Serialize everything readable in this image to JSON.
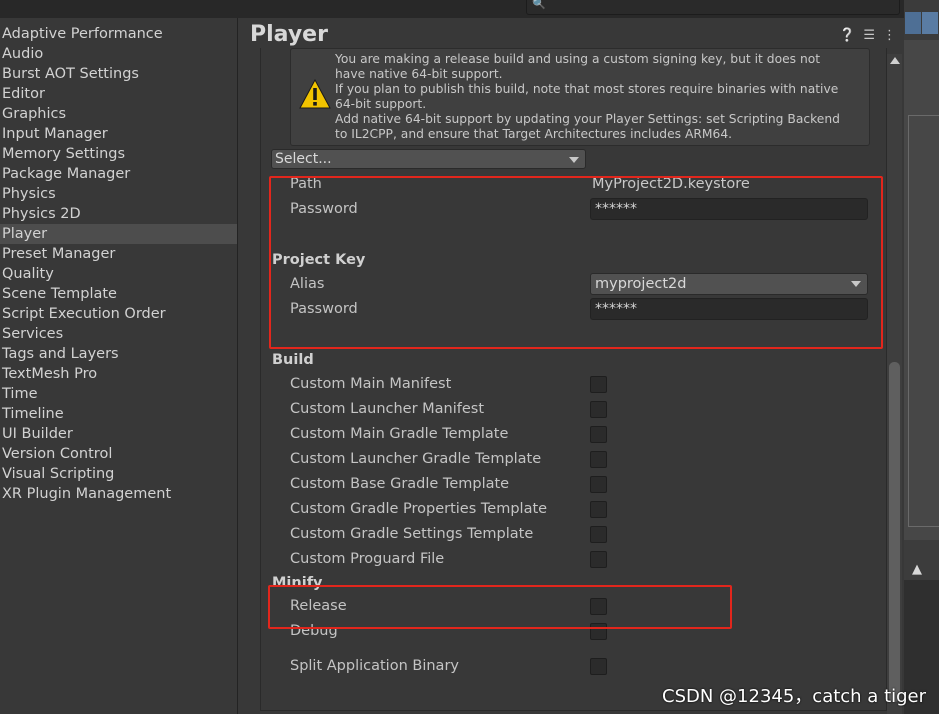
{
  "search": {
    "placeholder": ""
  },
  "sidebar": {
    "items": [
      {
        "label": "Adaptive Performance"
      },
      {
        "label": "Audio"
      },
      {
        "label": "Burst AOT Settings"
      },
      {
        "label": "Editor"
      },
      {
        "label": "Graphics"
      },
      {
        "label": "Input Manager"
      },
      {
        "label": "Memory Settings"
      },
      {
        "label": "Package Manager"
      },
      {
        "label": "Physics"
      },
      {
        "label": "Physics 2D"
      },
      {
        "label": "Player",
        "selected": true
      },
      {
        "label": "Preset Manager"
      },
      {
        "label": "Quality"
      },
      {
        "label": "Scene Template"
      },
      {
        "label": "Script Execution Order"
      },
      {
        "label": "Services"
      },
      {
        "label": "Tags and Layers"
      },
      {
        "label": "TextMesh Pro"
      },
      {
        "label": "Time"
      },
      {
        "label": "Timeline"
      },
      {
        "label": "UI Builder"
      },
      {
        "label": "Version Control"
      },
      {
        "label": "Visual Scripting"
      },
      {
        "label": "XR Plugin Management"
      }
    ]
  },
  "header": {
    "title": "Player",
    "icons": [
      "help-icon",
      "preset-icon",
      "more-icon"
    ]
  },
  "warning": {
    "text": "You are making a release build and using a custom signing key, but it does not\nhave native 64-bit support.\nIf you plan to publish this build, note that most stores require binaries with native\n64-bit support.\nAdd native 64-bit support by updating your Player Settings: set Scripting Backend\nto IL2CPP, and ensure that Target Architectures includes ARM64."
  },
  "keystore": {
    "select_label": "Select...",
    "path_label": "Path",
    "path_value": "MyProject2D.keystore",
    "password_label": "Password",
    "password_value": "******"
  },
  "project_key": {
    "heading": "Project Key",
    "alias_label": "Alias",
    "alias_value": "myproject2d",
    "password_label": "Password",
    "password_value": "******"
  },
  "build": {
    "heading": "Build",
    "items": [
      {
        "label": "Custom Main Manifest",
        "checked": false
      },
      {
        "label": "Custom Launcher Manifest",
        "checked": false
      },
      {
        "label": "Custom Main Gradle Template",
        "checked": false
      },
      {
        "label": "Custom Launcher Gradle Template",
        "checked": false
      },
      {
        "label": "Custom Base Gradle Template",
        "checked": false
      },
      {
        "label": "Custom Gradle Properties Template",
        "checked": false
      },
      {
        "label": "Custom Gradle Settings Template",
        "checked": false
      },
      {
        "label": "Custom Proguard File",
        "checked": false
      }
    ]
  },
  "minify": {
    "heading": "Minify",
    "release_label": "Release",
    "release_checked": false,
    "debug_label": "Debug",
    "debug_checked": false
  },
  "split": {
    "label": "Split Application Binary",
    "checked": false
  },
  "watermark": {
    "text": "CSDN @12345，catch a tiger"
  },
  "colors": {
    "highlight_red": "#e2261c",
    "selected_bg": "#4d4d4d"
  }
}
